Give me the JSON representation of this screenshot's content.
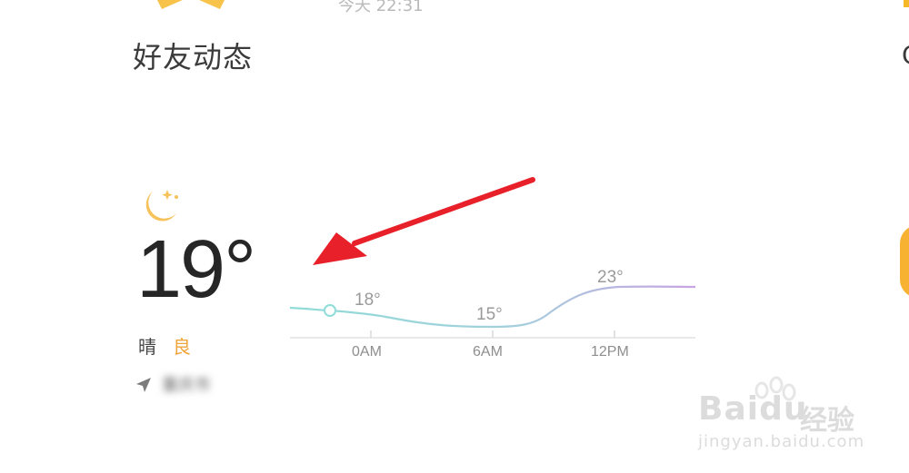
{
  "header": {
    "friends_label": "好友动态",
    "timestamp": "今天 22:31",
    "edge_letter": "C"
  },
  "weather": {
    "temperature": "19°",
    "condition": "晴",
    "aqi": "良",
    "location": "重庆市",
    "icons": [
      "moon-star-icon",
      "location-arrow-icon"
    ],
    "colors": {
      "aqi": "#f0a43a",
      "moon": "#f6c25c",
      "line_start": "#8fdcd8",
      "line_end": "#c8a3e3"
    }
  },
  "chart_data": {
    "type": "line",
    "categories": [
      "0AM",
      "6AM",
      "12PM"
    ],
    "labels": [
      "18°",
      "15°",
      "23°"
    ],
    "values": [
      18,
      15,
      23
    ]
  },
  "annotation": {
    "arrow_color": "#e8202a"
  },
  "watermark": {
    "brand": "Baidu",
    "brand_cn": "经验",
    "url": "jingyan.baidu.com"
  }
}
